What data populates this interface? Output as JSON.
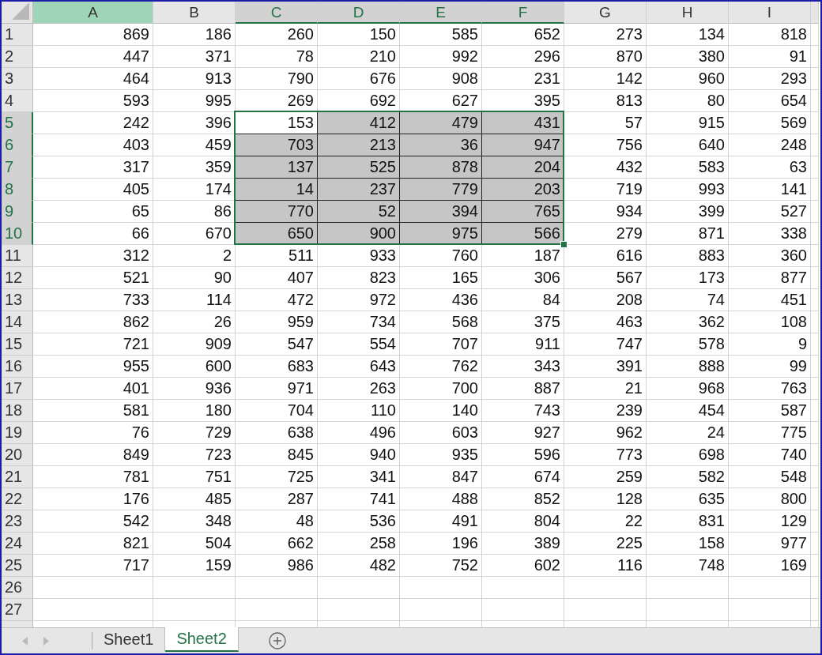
{
  "columns": [
    {
      "label": "A",
      "selected": false,
      "highlighted": true
    },
    {
      "label": "B",
      "selected": false,
      "highlighted": false
    },
    {
      "label": "C",
      "selected": true,
      "highlighted": false
    },
    {
      "label": "D",
      "selected": true,
      "highlighted": false
    },
    {
      "label": "E",
      "selected": true,
      "highlighted": false
    },
    {
      "label": "F",
      "selected": true,
      "highlighted": false
    },
    {
      "label": "G",
      "selected": false,
      "highlighted": false
    },
    {
      "label": "H",
      "selected": false,
      "highlighted": false
    },
    {
      "label": "I",
      "selected": false,
      "highlighted": false
    }
  ],
  "rows": [
    {
      "label": "1",
      "selected": false,
      "cells": [
        "869",
        "186",
        "260",
        "150",
        "585",
        "652",
        "273",
        "134",
        "818"
      ]
    },
    {
      "label": "2",
      "selected": false,
      "cells": [
        "447",
        "371",
        "78",
        "210",
        "992",
        "296",
        "870",
        "380",
        "91"
      ]
    },
    {
      "label": "3",
      "selected": false,
      "cells": [
        "464",
        "913",
        "790",
        "676",
        "908",
        "231",
        "142",
        "960",
        "293"
      ]
    },
    {
      "label": "4",
      "selected": false,
      "cells": [
        "593",
        "995",
        "269",
        "692",
        "627",
        "395",
        "813",
        "80",
        "654"
      ]
    },
    {
      "label": "5",
      "selected": true,
      "cells": [
        "242",
        "396",
        "153",
        "412",
        "479",
        "431",
        "57",
        "915",
        "569"
      ]
    },
    {
      "label": "6",
      "selected": true,
      "cells": [
        "403",
        "459",
        "703",
        "213",
        "36",
        "947",
        "756",
        "640",
        "248"
      ]
    },
    {
      "label": "7",
      "selected": true,
      "cells": [
        "317",
        "359",
        "137",
        "525",
        "878",
        "204",
        "432",
        "583",
        "63"
      ]
    },
    {
      "label": "8",
      "selected": true,
      "cells": [
        "405",
        "174",
        "14",
        "237",
        "779",
        "203",
        "719",
        "993",
        "141"
      ]
    },
    {
      "label": "9",
      "selected": true,
      "cells": [
        "65",
        "86",
        "770",
        "52",
        "394",
        "765",
        "934",
        "399",
        "527"
      ]
    },
    {
      "label": "10",
      "selected": true,
      "cells": [
        "66",
        "670",
        "650",
        "900",
        "975",
        "566",
        "279",
        "871",
        "338"
      ]
    },
    {
      "label": "11",
      "selected": false,
      "cells": [
        "312",
        "2",
        "511",
        "933",
        "760",
        "187",
        "616",
        "883",
        "360"
      ]
    },
    {
      "label": "12",
      "selected": false,
      "cells": [
        "521",
        "90",
        "407",
        "823",
        "165",
        "306",
        "567",
        "173",
        "877"
      ]
    },
    {
      "label": "13",
      "selected": false,
      "cells": [
        "733",
        "114",
        "472",
        "972",
        "436",
        "84",
        "208",
        "74",
        "451"
      ]
    },
    {
      "label": "14",
      "selected": false,
      "cells": [
        "862",
        "26",
        "959",
        "734",
        "568",
        "375",
        "463",
        "362",
        "108"
      ]
    },
    {
      "label": "15",
      "selected": false,
      "cells": [
        "721",
        "909",
        "547",
        "554",
        "707",
        "911",
        "747",
        "578",
        "9"
      ]
    },
    {
      "label": "16",
      "selected": false,
      "cells": [
        "955",
        "600",
        "683",
        "643",
        "762",
        "343",
        "391",
        "888",
        "99"
      ]
    },
    {
      "label": "17",
      "selected": false,
      "cells": [
        "401",
        "936",
        "971",
        "263",
        "700",
        "887",
        "21",
        "968",
        "763"
      ]
    },
    {
      "label": "18",
      "selected": false,
      "cells": [
        "581",
        "180",
        "704",
        "110",
        "140",
        "743",
        "239",
        "454",
        "587"
      ]
    },
    {
      "label": "19",
      "selected": false,
      "cells": [
        "76",
        "729",
        "638",
        "496",
        "603",
        "927",
        "962",
        "24",
        "775"
      ]
    },
    {
      "label": "20",
      "selected": false,
      "cells": [
        "849",
        "723",
        "845",
        "940",
        "935",
        "596",
        "773",
        "698",
        "740"
      ]
    },
    {
      "label": "21",
      "selected": false,
      "cells": [
        "781",
        "751",
        "725",
        "341",
        "847",
        "674",
        "259",
        "582",
        "548"
      ]
    },
    {
      "label": "22",
      "selected": false,
      "cells": [
        "176",
        "485",
        "287",
        "741",
        "488",
        "852",
        "128",
        "635",
        "800"
      ]
    },
    {
      "label": "23",
      "selected": false,
      "cells": [
        "542",
        "348",
        "48",
        "536",
        "491",
        "804",
        "22",
        "831",
        "129"
      ]
    },
    {
      "label": "24",
      "selected": false,
      "cells": [
        "821",
        "504",
        "662",
        "258",
        "196",
        "389",
        "225",
        "158",
        "977"
      ]
    },
    {
      "label": "25",
      "selected": false,
      "cells": [
        "717",
        "159",
        "986",
        "482",
        "752",
        "602",
        "116",
        "748",
        "169"
      ]
    },
    {
      "label": "26",
      "selected": false
    },
    {
      "label": "27",
      "selected": false
    }
  ],
  "sheet_tabs": [
    {
      "label": "Sheet1",
      "selected": false
    },
    {
      "label": "Sheet2",
      "selected": true
    }
  ]
}
